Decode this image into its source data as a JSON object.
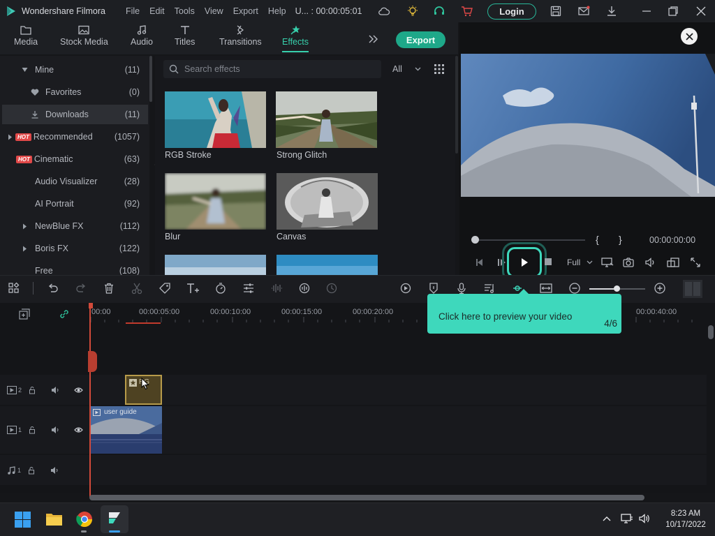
{
  "window": {
    "app_title": "Wondershare Filmora",
    "menu": [
      "File",
      "Edit",
      "Tools",
      "View",
      "Export",
      "Help"
    ],
    "project": "U... : 00:00:05:01",
    "login_label": "Login"
  },
  "tabs": [
    {
      "label": "Media",
      "icon": "folder-icon"
    },
    {
      "label": "Stock Media",
      "icon": "image-icon"
    },
    {
      "label": "Audio",
      "icon": "music-note-icon"
    },
    {
      "label": "Titles",
      "icon": "text-t-icon"
    },
    {
      "label": "Transitions",
      "icon": "transition-icon"
    },
    {
      "label": "Effects",
      "icon": "effects-star-icon",
      "active": true
    }
  ],
  "export_label": "Export",
  "library": {
    "items": [
      {
        "label": "Mine",
        "count": "(11)",
        "expanded": true
      },
      {
        "label": "Favorites",
        "count": "(0)"
      },
      {
        "label": "Downloads",
        "count": "(11)",
        "selected": true
      },
      {
        "label": "Recommended",
        "count": "(1057)",
        "hot": "HOT"
      },
      {
        "label": "Cinematic",
        "count": "(63)",
        "hot": "HOT"
      },
      {
        "label": "Audio Visualizer",
        "count": "(28)"
      },
      {
        "label": "AI Portrait",
        "count": "(92)"
      },
      {
        "label": "NewBlue FX",
        "count": "(112)"
      },
      {
        "label": "Boris FX",
        "count": "(122)"
      },
      {
        "label": "Free",
        "count": "(108)"
      }
    ]
  },
  "effects": {
    "search_placeholder": "Search effects",
    "filter_value": "All",
    "items": [
      {
        "label": "RGB Stroke"
      },
      {
        "label": "Strong Glitch"
      },
      {
        "label": "Blur"
      },
      {
        "label": "Canvas"
      }
    ]
  },
  "preview": {
    "brace_open": "{",
    "brace_close": "}",
    "timecode": "00:00:00:00",
    "quality": "Full"
  },
  "timeline": {
    "ruler": [
      "00:00",
      "00:00:05:00",
      "00:00:10:00",
      "00:00:15:00",
      "00:00:20:00",
      "00:00:40:00"
    ],
    "tracks": [
      {
        "number": "2",
        "type": "video"
      },
      {
        "number": "1",
        "type": "video"
      },
      {
        "number": "1",
        "type": "audio"
      }
    ],
    "clips": {
      "effect_clip_label": "RG",
      "video_clip_label": "user guide"
    }
  },
  "tooltip": {
    "message": "Click here to preview your video",
    "step": "4/6"
  },
  "taskbar": {
    "time": "8:23 AM",
    "date": "10/17/2022"
  },
  "colors": {
    "accent": "#37d0ac",
    "tooltip": "#3ed8bc",
    "playhead": "#d24a3a",
    "hot_badge": "#e04848"
  }
}
